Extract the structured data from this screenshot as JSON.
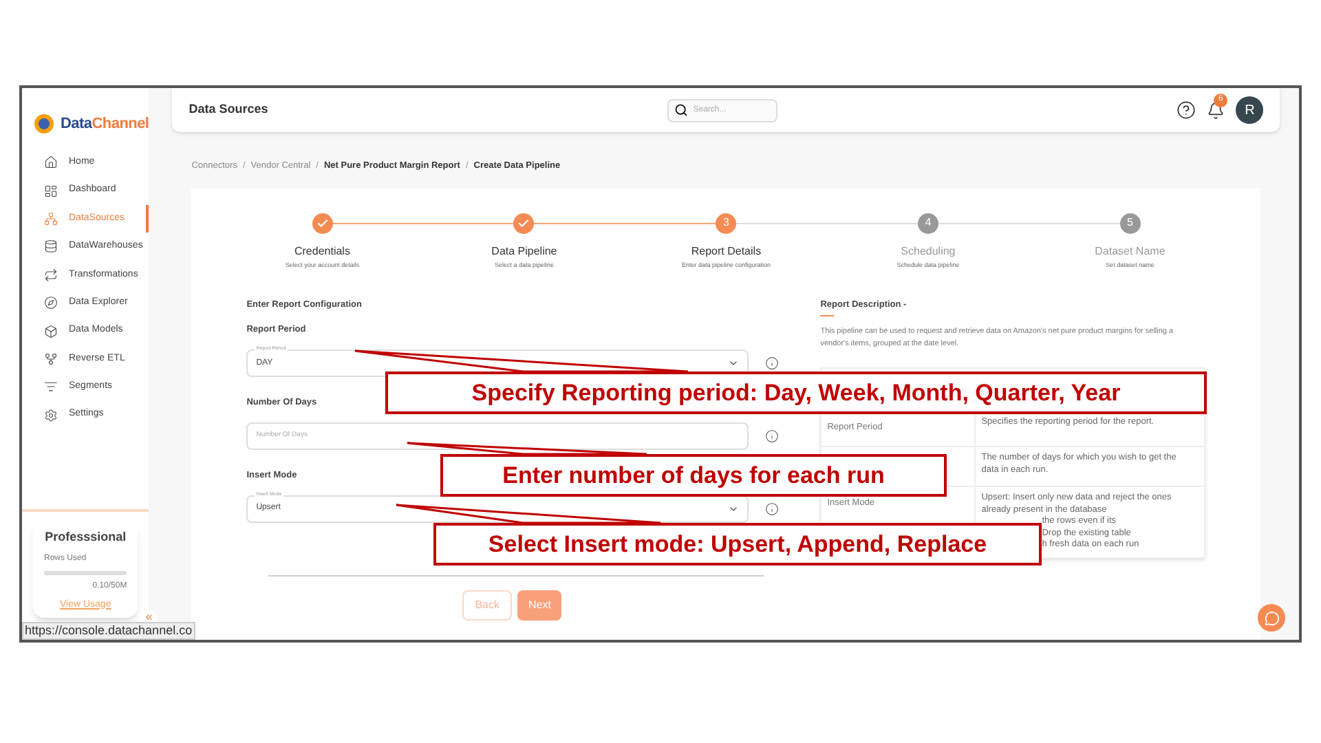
{
  "sidebar": {
    "logo": {
      "part_1": "Data",
      "part_2": "Channel"
    },
    "items": [
      {
        "label": "Home",
        "selected": false
      },
      {
        "label": "Dashboard",
        "selected": false
      },
      {
        "label": "DataSources",
        "selected": true
      },
      {
        "label": "DataWarehouses",
        "selected": false
      },
      {
        "label": "Transformations",
        "selected": false
      },
      {
        "label": "Data Explorer",
        "selected": false
      },
      {
        "label": "Data Models",
        "selected": false
      },
      {
        "label": "Reverse ETL",
        "selected": false
      },
      {
        "label": "Segments",
        "selected": false
      },
      {
        "label": "Settings",
        "selected": false
      }
    ],
    "plan": {
      "title": "Professsional",
      "usage_label": "Rows Used",
      "level": 0.0,
      "reading": "0.10/50M",
      "link": "View Usage"
    },
    "collapse": "«"
  },
  "status_url": "https://console.datachannel.co",
  "header": {
    "title": "Data Sources",
    "search_placeholder": "Search...",
    "notification_count": "6",
    "avatar": "R"
  },
  "breadcrumb": [
    {
      "label": "Connectors",
      "current": false
    },
    {
      "separator": "/",
      "label": "Vendor Central",
      "current": false
    },
    {
      "separator": "/",
      "label": "Net Pure Product Margin Report",
      "current": true
    },
    {
      "separator": "/",
      "label": "Create Data Pipeline",
      "current": true
    }
  ],
  "steps": [
    {
      "kind": "done",
      "title": "Credentials",
      "subtitle": "Select your account details"
    },
    {
      "kind": "done",
      "title": "Data Pipeline",
      "subtitle": "Select a data pipeline"
    },
    {
      "kind": "active",
      "number": "3",
      "title": "Report Details",
      "subtitle": "Enter data pipeline configuration"
    },
    {
      "kind": "pending",
      "number": "4",
      "title": "Scheduling",
      "subtitle": "Schedule data pipeline"
    },
    {
      "kind": "pending",
      "number": "5",
      "title": "Dataset Name",
      "subtitle": "Set dataset name"
    }
  ],
  "form": {
    "heading": "Enter Report Configuration",
    "fields": [
      {
        "kind": "select",
        "section": "Report Period",
        "label": "Report Period",
        "value": "DAY"
      },
      {
        "kind": "input",
        "section": "Number Of Days",
        "placeholder": "Number Of Days"
      },
      {
        "kind": "select",
        "section": "Insert Mode",
        "label": "Insert Mode",
        "value": "Upsert"
      }
    ]
  },
  "description": {
    "title": "Report Description -",
    "text": "This pipeline can be used to request and retrieve data on Amazon's net pure product margins for selling a vendor's items, grouped at the date level.",
    "rows": [
      {
        "parameter": "Report Period",
        "text": "Specifies the reporting period for the report."
      },
      {
        "text": "The number of days for which you wish to get the data in each run."
      },
      {
        "parameter": "Insert Mode",
        "text": "Upsert: Insert only new data and reject the ones already present in the database",
        "fragments": [
          "the rows even if its",
          "Drop the existing table",
          "h fresh data on each run"
        ]
      }
    ]
  },
  "buttons": [
    {
      "label": "Back",
      "kind": "secondary"
    },
    {
      "label": "Next",
      "kind": "primary"
    }
  ],
  "callouts": [
    {
      "text": "Specify Reporting period: Day, Week, Month, Quarter, Year"
    },
    {
      "text": "Enter number of days for each run"
    },
    {
      "text": "Select Insert mode: Upsert, Append, Replace"
    }
  ]
}
